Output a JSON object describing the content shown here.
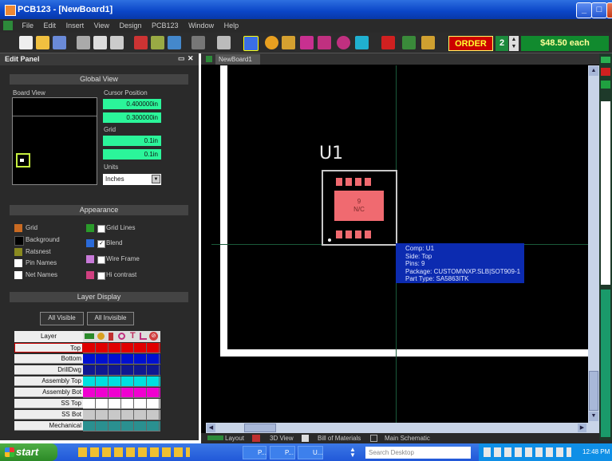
{
  "window": {
    "title": "PCB123 - [NewBoard1]"
  },
  "menu": [
    "File",
    "Edit",
    "Insert",
    "View",
    "Design",
    "PCB123",
    "Window",
    "Help"
  ],
  "toolbar": {
    "order_label": "ORDER",
    "quantity": "2",
    "price": "$48.50 each"
  },
  "edit_panel": {
    "title": "Edit Panel",
    "global_view": {
      "header": "Global View",
      "board_view_label": "Board View",
      "cursor_position_label": "Cursor Position",
      "cursor_x": "0.400000in",
      "cursor_y": "0.300000in",
      "grid_label": "Grid",
      "grid_x": "0.1in",
      "grid_y": "0.1in",
      "units_label": "Units",
      "units_value": "Inches"
    },
    "appearance": {
      "header": "Appearance",
      "left_items": [
        "Grid",
        "Background",
        "Ratsnest",
        "Pin Names",
        "Net Names"
      ],
      "right_items": [
        "Grid Lines",
        "Blend",
        "Wire Frame",
        "Hi contrast"
      ]
    },
    "layer_display": {
      "header": "Layer Display",
      "all_visible": "All Visible",
      "all_invisible": "All Invisible",
      "column_header": "Layer",
      "layers": [
        {
          "name": "Top",
          "color": "#e00000"
        },
        {
          "name": "Bottom",
          "color": "#0010d0"
        },
        {
          "name": "DrillDwg",
          "color": "#101890"
        },
        {
          "name": "Assembly Top",
          "color": "#00e0e0"
        },
        {
          "name": "Assembly Bot",
          "color": "#f000d0"
        },
        {
          "name": "SS Top",
          "color": "#ffffff"
        },
        {
          "name": "SS Bot",
          "color": "#c8c8c8"
        },
        {
          "name": "Mechanical",
          "color": "#2a9090"
        }
      ]
    }
  },
  "document_tab": "NewBoard1",
  "canvas": {
    "component_ref": "U1",
    "pad_label": "9",
    "pad_net": "N/C",
    "tooltip": [
      "Comp: U1",
      "Side: Top",
      "Pins: 9",
      "Package: CUSTOM\\NXP.SLB|SOT909-1",
      "Part Type: SA5863ITK"
    ]
  },
  "bottom_tabs": [
    "Layout",
    "3D View",
    "Bill of Materials",
    "Main Schematic"
  ],
  "taskbar": {
    "start": "start",
    "tasks": [
      "P...",
      "P...",
      "U..."
    ],
    "search_placeholder": "Search Desktop",
    "clock": "12:48 PM"
  }
}
